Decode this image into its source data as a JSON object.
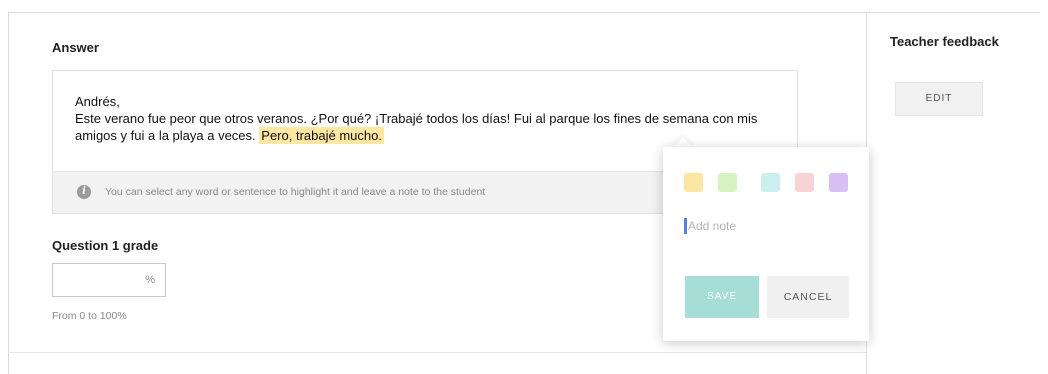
{
  "answer": {
    "title": "Answer",
    "greeting": "Andrés,",
    "body_before": "Este verano fue peor que otros veranos. ¿Por qué? ¡Trabajé todos los días! Fui al parque los fines de semana con mis amigos y fui a la playa a veces.",
    "highlighted": "Pero, trabajé mucho.",
    "hint": "You can select any word or sentence to highlight it and leave a note to the student",
    "hint_icon": "info-icon"
  },
  "grade": {
    "title": "Question 1 grade",
    "value": "",
    "unit": "%",
    "range": "From 0 to 100%"
  },
  "popover": {
    "swatches": [
      {
        "name": "yellow",
        "color": "#fbe6a2"
      },
      {
        "name": "green",
        "color": "#d6f2c0"
      },
      {
        "name": "teal",
        "color": "#cdeeee"
      },
      {
        "name": "pink",
        "color": "#f8d3d5"
      },
      {
        "name": "purple",
        "color": "#d9c0f4"
      }
    ],
    "note_placeholder": "Add note",
    "save_label": "SAVE",
    "cancel_label": "CANCEL"
  },
  "sidebar": {
    "title": "Teacher feedback",
    "edit_label": "EDIT"
  },
  "colors": {
    "highlight": "#fbe6a2",
    "save_button": "#a6ddd6",
    "caret": "#5a7fe0"
  }
}
